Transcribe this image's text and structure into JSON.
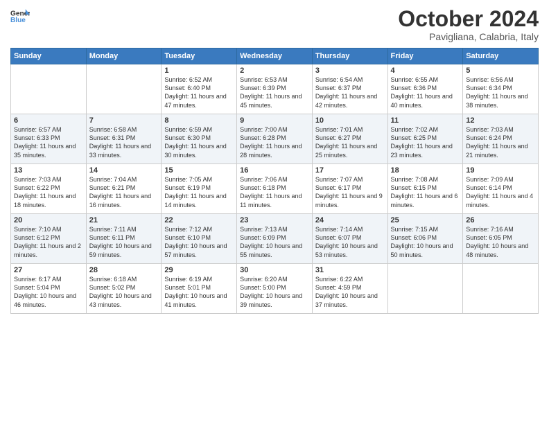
{
  "header": {
    "logo_line1": "General",
    "logo_line2": "Blue",
    "month_title": "October 2024",
    "location": "Pavigliana, Calabria, Italy"
  },
  "days_of_week": [
    "Sunday",
    "Monday",
    "Tuesday",
    "Wednesday",
    "Thursday",
    "Friday",
    "Saturday"
  ],
  "weeks": [
    [
      {
        "day": "",
        "sunrise": "",
        "sunset": "",
        "daylight": ""
      },
      {
        "day": "",
        "sunrise": "",
        "sunset": "",
        "daylight": ""
      },
      {
        "day": "1",
        "sunrise": "Sunrise: 6:52 AM",
        "sunset": "Sunset: 6:40 PM",
        "daylight": "Daylight: 11 hours and 47 minutes."
      },
      {
        "day": "2",
        "sunrise": "Sunrise: 6:53 AM",
        "sunset": "Sunset: 6:39 PM",
        "daylight": "Daylight: 11 hours and 45 minutes."
      },
      {
        "day": "3",
        "sunrise": "Sunrise: 6:54 AM",
        "sunset": "Sunset: 6:37 PM",
        "daylight": "Daylight: 11 hours and 42 minutes."
      },
      {
        "day": "4",
        "sunrise": "Sunrise: 6:55 AM",
        "sunset": "Sunset: 6:36 PM",
        "daylight": "Daylight: 11 hours and 40 minutes."
      },
      {
        "day": "5",
        "sunrise": "Sunrise: 6:56 AM",
        "sunset": "Sunset: 6:34 PM",
        "daylight": "Daylight: 11 hours and 38 minutes."
      }
    ],
    [
      {
        "day": "6",
        "sunrise": "Sunrise: 6:57 AM",
        "sunset": "Sunset: 6:33 PM",
        "daylight": "Daylight: 11 hours and 35 minutes."
      },
      {
        "day": "7",
        "sunrise": "Sunrise: 6:58 AM",
        "sunset": "Sunset: 6:31 PM",
        "daylight": "Daylight: 11 hours and 33 minutes."
      },
      {
        "day": "8",
        "sunrise": "Sunrise: 6:59 AM",
        "sunset": "Sunset: 6:30 PM",
        "daylight": "Daylight: 11 hours and 30 minutes."
      },
      {
        "day": "9",
        "sunrise": "Sunrise: 7:00 AM",
        "sunset": "Sunset: 6:28 PM",
        "daylight": "Daylight: 11 hours and 28 minutes."
      },
      {
        "day": "10",
        "sunrise": "Sunrise: 7:01 AM",
        "sunset": "Sunset: 6:27 PM",
        "daylight": "Daylight: 11 hours and 25 minutes."
      },
      {
        "day": "11",
        "sunrise": "Sunrise: 7:02 AM",
        "sunset": "Sunset: 6:25 PM",
        "daylight": "Daylight: 11 hours and 23 minutes."
      },
      {
        "day": "12",
        "sunrise": "Sunrise: 7:03 AM",
        "sunset": "Sunset: 6:24 PM",
        "daylight": "Daylight: 11 hours and 21 minutes."
      }
    ],
    [
      {
        "day": "13",
        "sunrise": "Sunrise: 7:03 AM",
        "sunset": "Sunset: 6:22 PM",
        "daylight": "Daylight: 11 hours and 18 minutes."
      },
      {
        "day": "14",
        "sunrise": "Sunrise: 7:04 AM",
        "sunset": "Sunset: 6:21 PM",
        "daylight": "Daylight: 11 hours and 16 minutes."
      },
      {
        "day": "15",
        "sunrise": "Sunrise: 7:05 AM",
        "sunset": "Sunset: 6:19 PM",
        "daylight": "Daylight: 11 hours and 14 minutes."
      },
      {
        "day": "16",
        "sunrise": "Sunrise: 7:06 AM",
        "sunset": "Sunset: 6:18 PM",
        "daylight": "Daylight: 11 hours and 11 minutes."
      },
      {
        "day": "17",
        "sunrise": "Sunrise: 7:07 AM",
        "sunset": "Sunset: 6:17 PM",
        "daylight": "Daylight: 11 hours and 9 minutes."
      },
      {
        "day": "18",
        "sunrise": "Sunrise: 7:08 AM",
        "sunset": "Sunset: 6:15 PM",
        "daylight": "Daylight: 11 hours and 6 minutes."
      },
      {
        "day": "19",
        "sunrise": "Sunrise: 7:09 AM",
        "sunset": "Sunset: 6:14 PM",
        "daylight": "Daylight: 11 hours and 4 minutes."
      }
    ],
    [
      {
        "day": "20",
        "sunrise": "Sunrise: 7:10 AM",
        "sunset": "Sunset: 6:12 PM",
        "daylight": "Daylight: 11 hours and 2 minutes."
      },
      {
        "day": "21",
        "sunrise": "Sunrise: 7:11 AM",
        "sunset": "Sunset: 6:11 PM",
        "daylight": "Daylight: 10 hours and 59 minutes."
      },
      {
        "day": "22",
        "sunrise": "Sunrise: 7:12 AM",
        "sunset": "Sunset: 6:10 PM",
        "daylight": "Daylight: 10 hours and 57 minutes."
      },
      {
        "day": "23",
        "sunrise": "Sunrise: 7:13 AM",
        "sunset": "Sunset: 6:09 PM",
        "daylight": "Daylight: 10 hours and 55 minutes."
      },
      {
        "day": "24",
        "sunrise": "Sunrise: 7:14 AM",
        "sunset": "Sunset: 6:07 PM",
        "daylight": "Daylight: 10 hours and 53 minutes."
      },
      {
        "day": "25",
        "sunrise": "Sunrise: 7:15 AM",
        "sunset": "Sunset: 6:06 PM",
        "daylight": "Daylight: 10 hours and 50 minutes."
      },
      {
        "day": "26",
        "sunrise": "Sunrise: 7:16 AM",
        "sunset": "Sunset: 6:05 PM",
        "daylight": "Daylight: 10 hours and 48 minutes."
      }
    ],
    [
      {
        "day": "27",
        "sunrise": "Sunrise: 6:17 AM",
        "sunset": "Sunset: 5:04 PM",
        "daylight": "Daylight: 10 hours and 46 minutes."
      },
      {
        "day": "28",
        "sunrise": "Sunrise: 6:18 AM",
        "sunset": "Sunset: 5:02 PM",
        "daylight": "Daylight: 10 hours and 43 minutes."
      },
      {
        "day": "29",
        "sunrise": "Sunrise: 6:19 AM",
        "sunset": "Sunset: 5:01 PM",
        "daylight": "Daylight: 10 hours and 41 minutes."
      },
      {
        "day": "30",
        "sunrise": "Sunrise: 6:20 AM",
        "sunset": "Sunset: 5:00 PM",
        "daylight": "Daylight: 10 hours and 39 minutes."
      },
      {
        "day": "31",
        "sunrise": "Sunrise: 6:22 AM",
        "sunset": "Sunset: 4:59 PM",
        "daylight": "Daylight: 10 hours and 37 minutes."
      },
      {
        "day": "",
        "sunrise": "",
        "sunset": "",
        "daylight": ""
      },
      {
        "day": "",
        "sunrise": "",
        "sunset": "",
        "daylight": ""
      }
    ]
  ]
}
